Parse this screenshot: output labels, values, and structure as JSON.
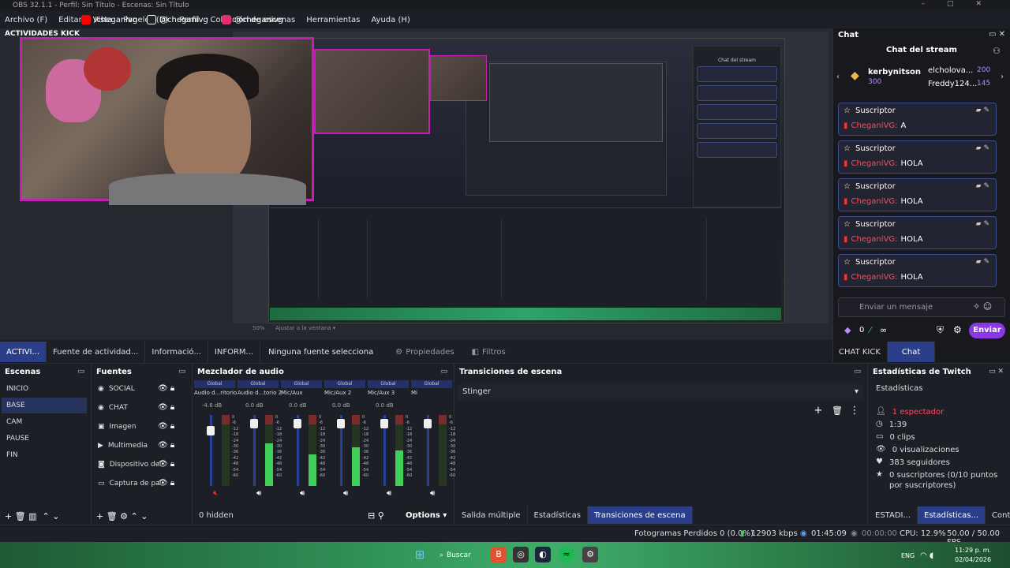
{
  "window": {
    "title": "OBS 32.1.1 - Perfil: Sin Título - Escenas: Sin Título"
  },
  "menu": [
    "Archivo (F)",
    "Editar",
    "Vista",
    "Paneles (D)",
    "Perfil",
    "Colección de escenas",
    "Herramientas",
    "Ayuda (H)"
  ],
  "preview": {
    "dock_title": "ACTIVIDADES KICK",
    "social": [
      {
        "handle": "/cheganivg",
        "icon": "youtube-icon",
        "color": "#ff0000"
      },
      {
        "handle": "@cheganivg",
        "icon": "tiktok-icon",
        "color": "#ffffff"
      },
      {
        "handle": "@cheganivg",
        "icon": "instagram-icon",
        "color": "#e1306c"
      }
    ],
    "zoom": "50%",
    "zoom_mode": "Ajustar a la ventana"
  },
  "context_tabs": {
    "tabs": [
      "ACTIVI...",
      "Fuente de actividad...",
      "Informació...",
      "INFORM..."
    ],
    "active_index": 0,
    "source_label": "Ninguna fuente selecciona",
    "properties": "Propiedades",
    "filters": "Filtros"
  },
  "chat": {
    "dock_title": "Chat",
    "header": "Chat del stream",
    "leaders": [
      {
        "name": "kerbynitson",
        "points": "300"
      },
      {
        "name": "elcholova...",
        "points": "200"
      },
      {
        "name": "Freddy124...",
        "points": "145"
      }
    ],
    "messages": [
      {
        "role": "Suscriptor",
        "nick": "CheganiVG:",
        "text": "A"
      },
      {
        "role": "Suscriptor",
        "nick": "CheganiVG:",
        "text": "HOLA"
      },
      {
        "role": "Suscriptor",
        "nick": "CheganiVG:",
        "text": "HOLA"
      },
      {
        "role": "Suscriptor",
        "nick": "CheganiVG:",
        "text": "HOLA"
      },
      {
        "role": "Suscriptor",
        "nick": "CheganiVG:",
        "text": "HOLA"
      }
    ],
    "input_placeholder": "Enviar un mensaje",
    "points": "0",
    "infinity": "∞",
    "send": "Enviar",
    "tabs": [
      "CHAT KICK",
      "Chat"
    ],
    "active_tab": 1
  },
  "scenes": {
    "title": "Escenas",
    "items": [
      "INICIO",
      "BASE",
      "CAM",
      "PAUSE",
      "FIN"
    ],
    "selected": 1
  },
  "sources": {
    "title": "Fuentes",
    "items": [
      {
        "label": "SOCIAL",
        "icon": "globe-icon"
      },
      {
        "label": "CHAT",
        "icon": "globe-icon"
      },
      {
        "label": "Imagen",
        "icon": "image-icon"
      },
      {
        "label": "Multimedia",
        "icon": "play-icon"
      },
      {
        "label": "Dispositivo de",
        "icon": "camera-icon"
      },
      {
        "label": "Captura de pa",
        "icon": "monitor-icon"
      }
    ]
  },
  "mixer": {
    "title": "Mezclador de audio",
    "channels": [
      {
        "group": "Global",
        "name": "Audio d...ritorio",
        "db": "-4.6 dB",
        "level": 0.85,
        "fill": 0.0,
        "muted": true
      },
      {
        "group": "Global",
        "name": "Audio d...torio 2",
        "db": "0.0 dB",
        "level": 0.95,
        "fill": 0.6,
        "muted": false
      },
      {
        "group": "Global",
        "name": "Mic/Aux",
        "db": "0.0 dB",
        "level": 0.95,
        "fill": 0.45,
        "muted": false
      },
      {
        "group": "Global",
        "name": "Mic/Aux 2",
        "db": "0.0 dB",
        "level": 0.95,
        "fill": 0.55,
        "muted": false
      },
      {
        "group": "Global",
        "name": "Mic/Aux 3",
        "db": "0.0 dB",
        "level": 0.95,
        "fill": 0.5,
        "muted": false
      },
      {
        "group": "Global",
        "name": "Mi",
        "db": "",
        "level": 0.95,
        "fill": 0.0,
        "muted": false
      }
    ],
    "scale": [
      "0",
      "-6",
      "-12",
      "-18",
      "-24",
      "-30",
      "-36",
      "-42",
      "-48",
      "-54",
      "-60"
    ],
    "hidden": "0 hidden",
    "options": "Options"
  },
  "transitions": {
    "title": "Transiciones de escena",
    "selected": "Stinger",
    "tabs": [
      "Salida múltiple",
      "Estadísticas",
      "Transiciones de escena"
    ],
    "active_tab": 2
  },
  "twitch": {
    "title": "Estadísticas de Twitch",
    "subtitle": "Estadísticas",
    "rows": [
      {
        "icon": "user-icon",
        "text": "1 espectador",
        "color": "#ff4a62"
      },
      {
        "icon": "clock-icon",
        "text": "1:39",
        "color": "#dddddd"
      },
      {
        "icon": "clip-icon",
        "text": "0 clips",
        "color": "#dddddd"
      },
      {
        "icon": "eye-icon",
        "text": "0 visualizaciones",
        "color": "#dddddd"
      },
      {
        "icon": "heart-icon",
        "text": "383 seguidores",
        "color": "#dddddd"
      },
      {
        "icon": "star-icon",
        "text": "0 suscriptores (0/10 puntos por suscriptores)",
        "color": "#dddddd"
      }
    ],
    "tabs": [
      "ESTADI...",
      "Estadísticas...",
      "Contr..."
    ],
    "active_tab": 1
  },
  "status": {
    "dropped": "Fotogramas Perdidos 0 (0.0%)",
    "bitrate": "12903 kbps",
    "live_time": "01:45:09",
    "rec_time": "00:00:00",
    "cpu": "CPU: 12.9%",
    "fps": "50.00 / 50.00 FPS"
  },
  "taskbar": {
    "search": "Buscar",
    "lang": "ENG",
    "time": "11:29 p. m.",
    "date": "02/04/2026"
  },
  "colors": {
    "accent": "#2a3e8a",
    "brand": "#8a38e6",
    "cam_border": "#c21fb5"
  }
}
